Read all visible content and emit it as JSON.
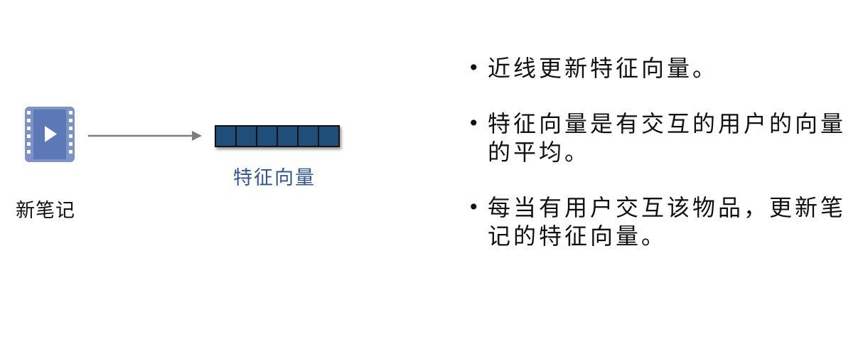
{
  "left": {
    "note_label": "新笔记",
    "icon": "video-file-icon",
    "arrow": "right-arrow-icon"
  },
  "vector": {
    "cells": 6,
    "label": "特征向量",
    "fill_color": "#1f4e79",
    "label_color": "#2f5597"
  },
  "bullets": [
    {
      "text": "近线更新特征向量。"
    },
    {
      "text": "特征向量是有交互的用户的向量的平均。"
    },
    {
      "text": "每当有用户交互该物品，更新笔记的特征向量。"
    }
  ]
}
